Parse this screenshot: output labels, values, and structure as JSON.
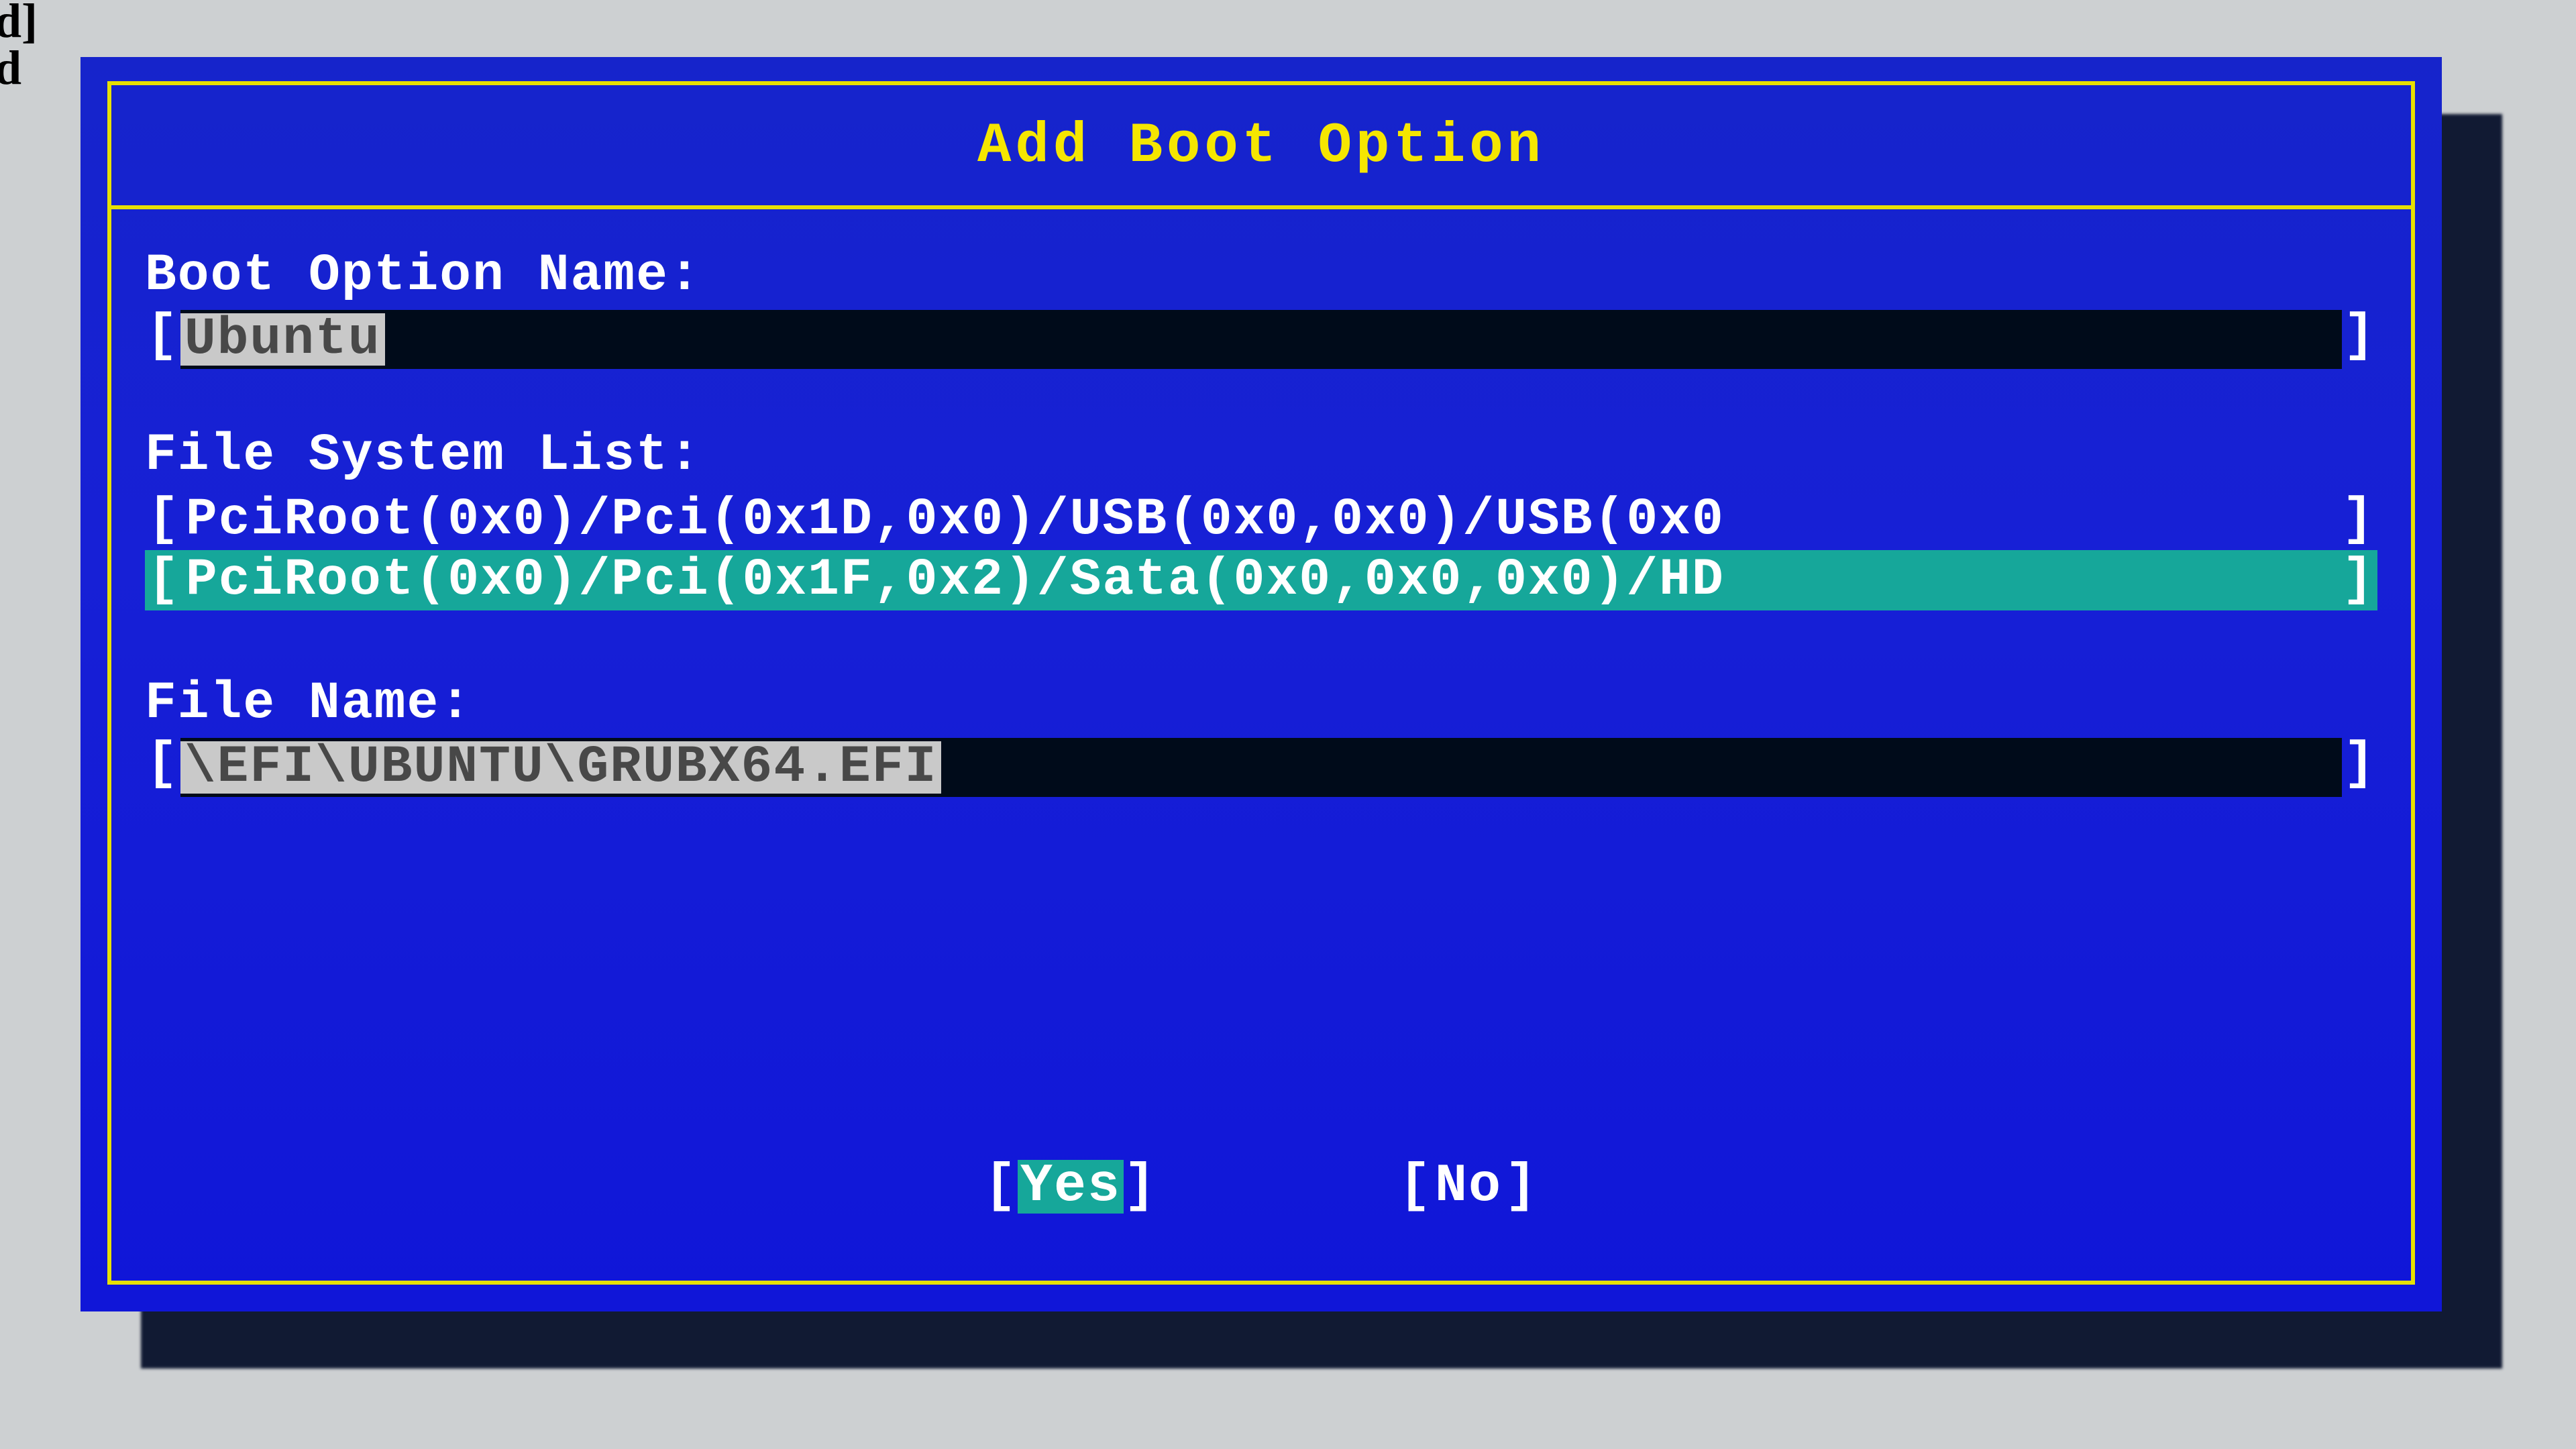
{
  "colors": {
    "accent_border": "#e7e000",
    "title_text": "#f5e600",
    "bg_dialog": "#1720d6",
    "selection_bg": "#16a79a",
    "input_bg": "#000b1a"
  },
  "bg_text_1": "ed]",
  "bg_text_2": "ed",
  "dialog": {
    "title": "Add Boot Option",
    "boot_option_name": {
      "label": "Boot Option Name:",
      "value": "Ubuntu"
    },
    "file_system_list": {
      "label": "File System List:",
      "items": [
        {
          "text": "PciRoot(0x0)/Pci(0x1D,0x0)/USB(0x0,0x0)/USB(0x0",
          "selected": false
        },
        {
          "text": "PciRoot(0x0)/Pci(0x1F,0x2)/Sata(0x0,0x0,0x0)/HD",
          "selected": true
        }
      ]
    },
    "file_name": {
      "label": "File Name:",
      "value": "\\EFI\\UBUNTU\\GRUBX64.EFI"
    },
    "buttons": {
      "yes": {
        "open": "[",
        "label": "Yes",
        "close": "]",
        "selected": true
      },
      "no": {
        "open": "[",
        "label": "No",
        "close": "]",
        "selected": false
      }
    },
    "brackets": {
      "open": "[",
      "close": "]"
    }
  }
}
